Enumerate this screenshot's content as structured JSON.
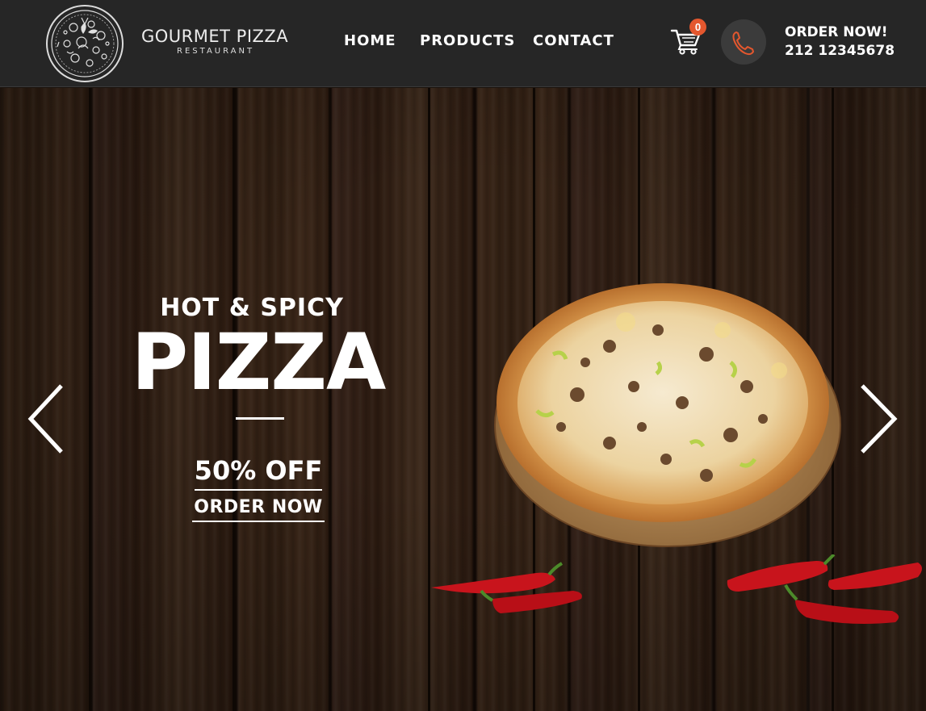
{
  "header": {
    "brand_name": "GOURMET PIZZA",
    "brand_sub": "RESTAURANT",
    "logo_icon": "pizza-sketch-logo",
    "nav": [
      {
        "label": "HOME"
      },
      {
        "label": "PRODUCTS"
      },
      {
        "label": "CONTACT"
      }
    ],
    "cart_icon": "shopping-cart-icon",
    "cart_count": "0",
    "phone_icon": "phone-icon",
    "order_label": "ORDER NOW!",
    "phone_number": "212 12345678"
  },
  "hero": {
    "subtitle": "HOT & SPICY",
    "title": "PIZZA",
    "offer": "50% OFF",
    "cta": "ORDER NOW",
    "prev_icon": "chevron-left-icon",
    "next_icon": "chevron-right-icon"
  },
  "colors": {
    "header_bg": "#262626",
    "accent": "#e4572e",
    "wood_dark": "#2c1b10"
  }
}
